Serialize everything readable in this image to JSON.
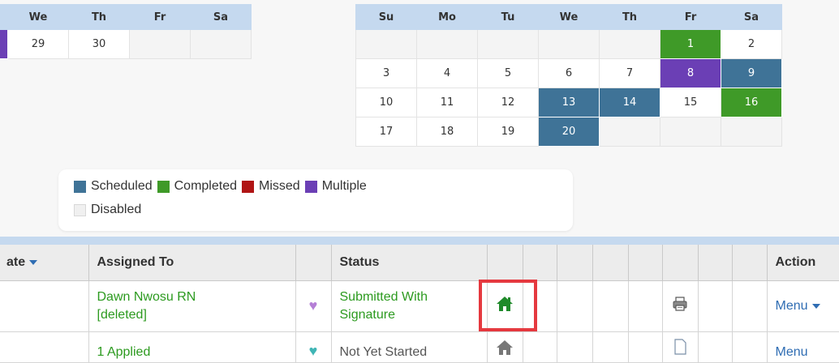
{
  "cal_left": {
    "days": [
      "",
      "We",
      "Th",
      "Fr",
      "Sa"
    ],
    "rows": [
      [
        {
          "t": "",
          "s": "multiple"
        },
        {
          "t": "29",
          "s": ""
        },
        {
          "t": "30",
          "s": ""
        },
        {
          "t": "",
          "s": "empty"
        },
        {
          "t": "",
          "s": "empty"
        }
      ]
    ]
  },
  "cal_right": {
    "days": [
      "Su",
      "Mo",
      "Tu",
      "We",
      "Th",
      "Fr",
      "Sa"
    ],
    "rows": [
      [
        {
          "t": "",
          "s": "empty"
        },
        {
          "t": "",
          "s": "empty"
        },
        {
          "t": "",
          "s": "empty"
        },
        {
          "t": "",
          "s": "empty"
        },
        {
          "t": "",
          "s": "empty"
        },
        {
          "t": "1",
          "s": "completed"
        },
        {
          "t": "2",
          "s": ""
        }
      ],
      [
        {
          "t": "3",
          "s": ""
        },
        {
          "t": "4",
          "s": ""
        },
        {
          "t": "5",
          "s": ""
        },
        {
          "t": "6",
          "s": ""
        },
        {
          "t": "7",
          "s": ""
        },
        {
          "t": "8",
          "s": "multiple"
        },
        {
          "t": "9",
          "s": "scheduled"
        }
      ],
      [
        {
          "t": "10",
          "s": ""
        },
        {
          "t": "11",
          "s": ""
        },
        {
          "t": "12",
          "s": ""
        },
        {
          "t": "13",
          "s": "scheduled"
        },
        {
          "t": "14",
          "s": "scheduled"
        },
        {
          "t": "15",
          "s": ""
        },
        {
          "t": "16",
          "s": "completed"
        }
      ],
      [
        {
          "t": "17",
          "s": ""
        },
        {
          "t": "18",
          "s": ""
        },
        {
          "t": "19",
          "s": ""
        },
        {
          "t": "20",
          "s": "scheduled"
        },
        {
          "t": "",
          "s": "empty"
        },
        {
          "t": "",
          "s": "empty"
        },
        {
          "t": "",
          "s": "empty"
        }
      ]
    ]
  },
  "legend": {
    "items": [
      {
        "label": "Scheduled",
        "color": "#3f7397"
      },
      {
        "label": "Completed",
        "color": "#3f9a28"
      },
      {
        "label": "Missed",
        "color": "#b01515"
      },
      {
        "label": "Multiple",
        "color": "#6b3fb5"
      }
    ],
    "disabled": {
      "label": "Disabled",
      "color": "#f0f0f0"
    }
  },
  "grid": {
    "headers": {
      "date": "ate",
      "assigned": "Assigned To",
      "status": "Status",
      "action": "Action"
    },
    "row1": {
      "assigned_line1": "Dawn Nwosu RN",
      "assigned_line2": "[deleted]",
      "heart": "♥",
      "status_line1": "Submitted With",
      "status_line2": "Signature",
      "action": "Menu"
    },
    "row2": {
      "assigned": "1 Applied",
      "status": "Not Yet Started",
      "action": "Menu"
    }
  }
}
